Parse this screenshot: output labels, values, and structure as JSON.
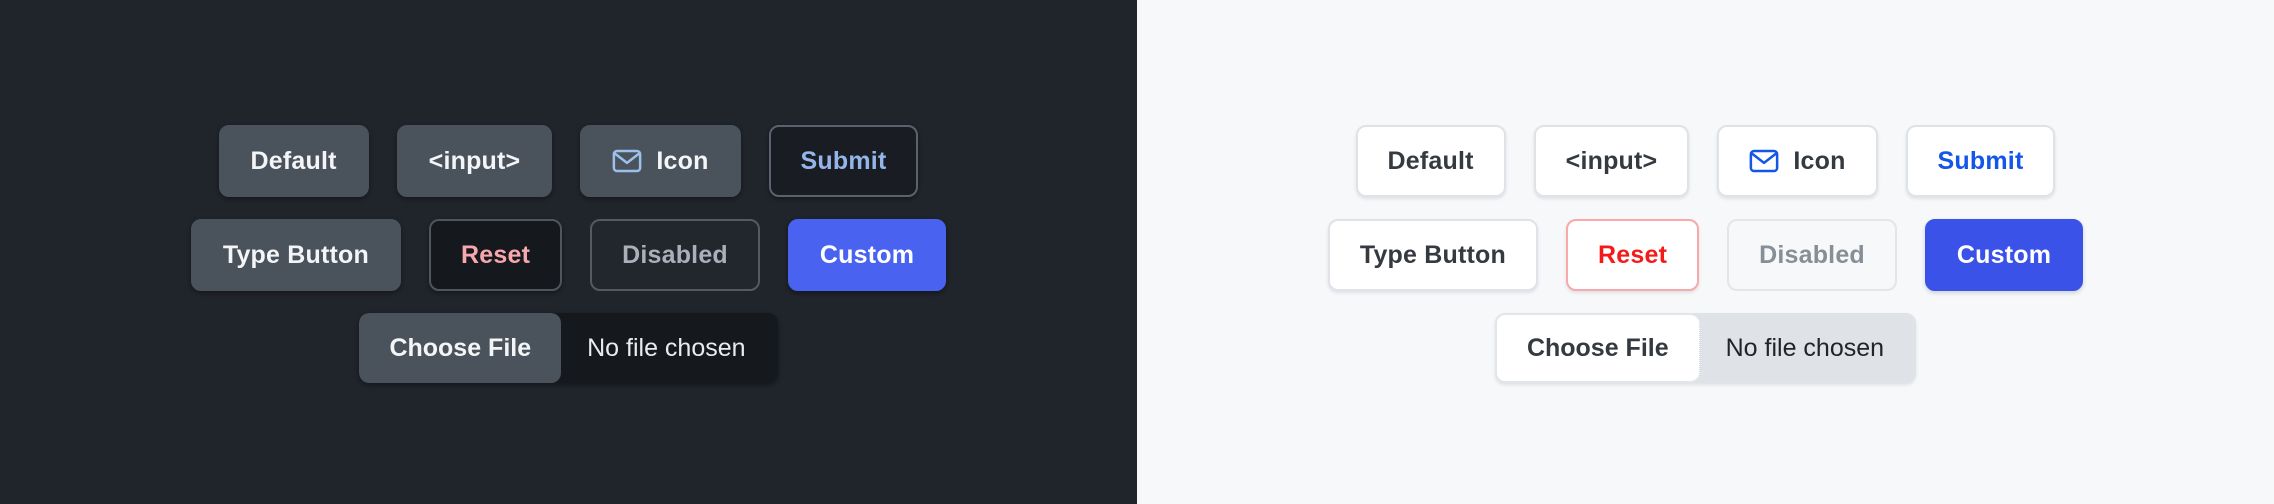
{
  "panes": [
    {
      "theme": "dark",
      "background": "#20242b",
      "rows": [
        {
          "buttons": [
            {
              "label": "Default",
              "variant": "default"
            },
            {
              "label": "<input>",
              "variant": "input"
            },
            {
              "label": "Icon",
              "variant": "icon",
              "icon": "mail-icon"
            },
            {
              "label": "Submit",
              "variant": "submit"
            }
          ]
        },
        {
          "buttons": [
            {
              "label": "Type Button",
              "variant": "type"
            },
            {
              "label": "Reset",
              "variant": "reset"
            },
            {
              "label": "Disabled",
              "variant": "disabled"
            },
            {
              "label": "Custom",
              "variant": "custom"
            }
          ]
        }
      ],
      "file_input": {
        "button_label": "Choose File",
        "status_text": "No file chosen"
      }
    },
    {
      "theme": "light",
      "background": "#f6f8fa",
      "rows": [
        {
          "buttons": [
            {
              "label": "Default",
              "variant": "default"
            },
            {
              "label": "<input>",
              "variant": "input"
            },
            {
              "label": "Icon",
              "variant": "icon",
              "icon": "mail-icon"
            },
            {
              "label": "Submit",
              "variant": "submit"
            }
          ]
        },
        {
          "buttons": [
            {
              "label": "Type Button",
              "variant": "type"
            },
            {
              "label": "Reset",
              "variant": "reset"
            },
            {
              "label": "Disabled",
              "variant": "disabled"
            },
            {
              "label": "Custom",
              "variant": "custom"
            }
          ]
        }
      ],
      "file_input": {
        "button_label": "Choose File",
        "status_text": "No file chosen"
      }
    }
  ],
  "colors": {
    "dark_bg": "#20242b",
    "dark_button_bg": "#4a525c",
    "dark_button_text": "#f3f5f7",
    "dark_submit_text": "#93b5e8",
    "dark_reset_text": "#f6a8ae",
    "dark_disabled_text": "#a9b0ba",
    "dark_custom_bg": "#4a62f0",
    "dark_icon_stroke": "#9dc0ea",
    "light_bg": "#f6f8fa",
    "light_button_bg": "#ffffff",
    "light_button_text": "#343a40",
    "light_submit_text": "#1356e8",
    "light_reset_text": "#f41a1a",
    "light_reset_border": "#f9a9a9",
    "light_disabled_text": "#868e96",
    "light_custom_bg": "#3b52e8",
    "light_icon_stroke": "#1356e8",
    "light_file_track_bg": "#dfe2e6"
  },
  "labels": {
    "dark": {
      "r1b1": "Default",
      "r1b2": "<input>",
      "r1b3": "Icon",
      "r1b4": "Submit",
      "r2b1": "Type Button",
      "r2b2": "Reset",
      "r2b3": "Disabled",
      "r2b4": "Custom",
      "file_button": "Choose File",
      "file_status": "No file chosen"
    },
    "light": {
      "r1b1": "Default",
      "r1b2": "<input>",
      "r1b3": "Icon",
      "r1b4": "Submit",
      "r2b1": "Type Button",
      "r2b2": "Reset",
      "r2b3": "Disabled",
      "r2b4": "Custom",
      "file_button": "Choose File",
      "file_status": "No file chosen"
    }
  }
}
